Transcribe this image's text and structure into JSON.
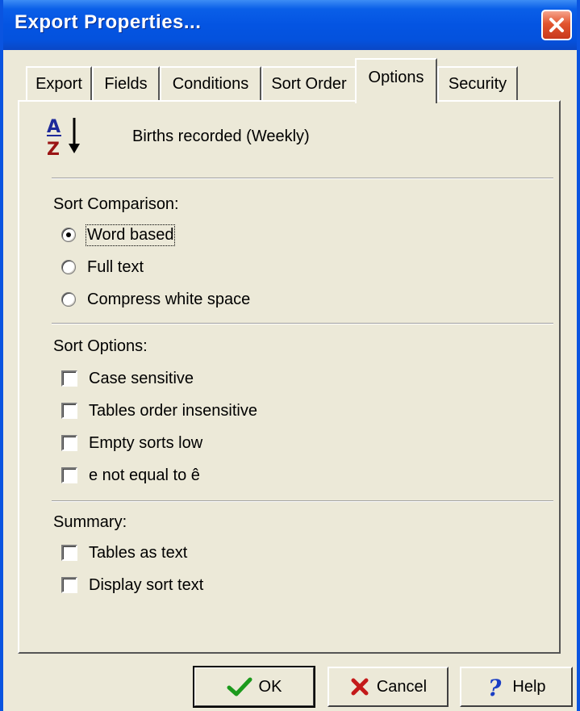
{
  "window": {
    "title": "Export Properties..."
  },
  "tabs": [
    {
      "label": "Export"
    },
    {
      "label": "Fields"
    },
    {
      "label": "Conditions"
    },
    {
      "label": "Sort Order"
    },
    {
      "label": "Options",
      "active": true
    },
    {
      "label": "Security"
    }
  ],
  "report": {
    "name": "Births recorded (Weekly)",
    "icon": "sort-az-icon"
  },
  "sort_comparison": {
    "label": "Sort Comparison:",
    "options": [
      {
        "label": "Word based",
        "selected": true
      },
      {
        "label": "Full text",
        "selected": false
      },
      {
        "label": "Compress white space",
        "selected": false
      }
    ]
  },
  "sort_options": {
    "label": "Sort Options:",
    "items": [
      {
        "label": "Case sensitive",
        "checked": false
      },
      {
        "label": "Tables order insensitive",
        "checked": false
      },
      {
        "label": "Empty sorts low",
        "checked": false
      },
      {
        "label": "e not equal to ê",
        "checked": false
      }
    ]
  },
  "summary": {
    "label": "Summary:",
    "items": [
      {
        "label": "Tables as text",
        "checked": false
      },
      {
        "label": "Display sort text",
        "checked": false
      }
    ]
  },
  "buttons": {
    "ok": "OK",
    "cancel": "Cancel",
    "help": "Help"
  },
  "colors": {
    "titlebar": "#0454e2",
    "close": "#e2552e",
    "face": "#ece9d8"
  }
}
